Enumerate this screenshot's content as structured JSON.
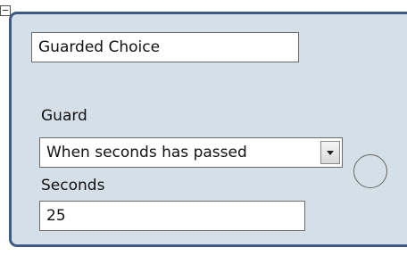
{
  "node": {
    "name_value": "Guarded Choice",
    "guard_label": "Guard",
    "guard_selected": "When seconds has passed",
    "seconds_label": "Seconds",
    "seconds_value": "25"
  },
  "icons": {
    "collapse": "minus-box-icon",
    "dropdown": "chevron-down-icon",
    "port": "circle-port"
  },
  "colors": {
    "panel_bg": "#d5dfe7",
    "panel_border": "#3d5a85"
  }
}
